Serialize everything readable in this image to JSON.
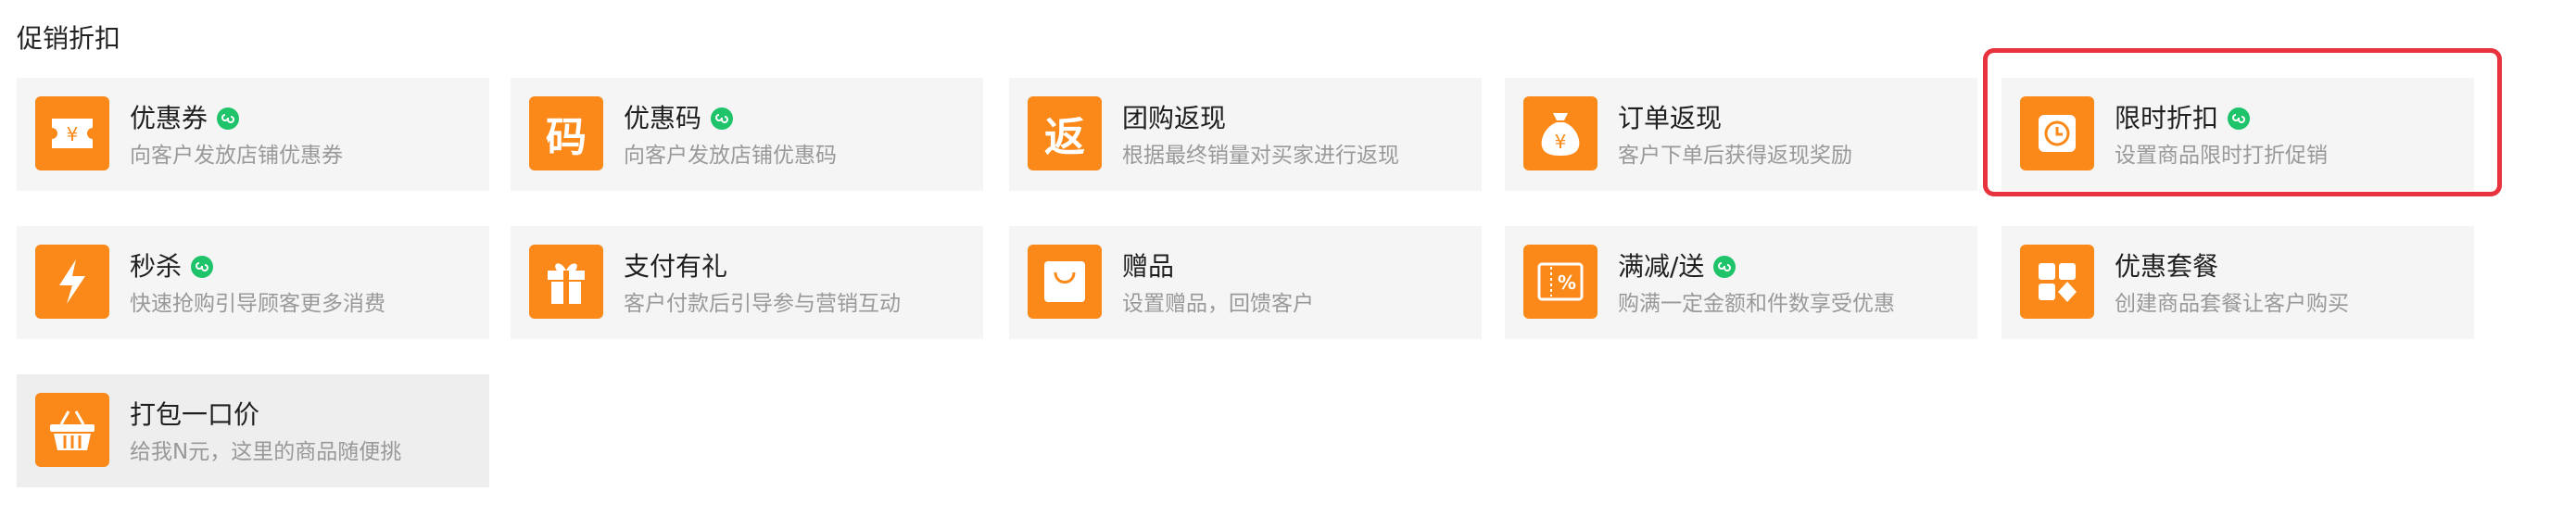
{
  "section": {
    "title": "促销折扣"
  },
  "cards": [
    {
      "title": "优惠券",
      "desc": "向客户发放店铺优惠券",
      "icon": "ticket-icon",
      "mini_program": true
    },
    {
      "title": "优惠码",
      "desc": "向客户发放店铺优惠码",
      "icon": "code-char-icon",
      "icon_text": "码",
      "mini_program": true
    },
    {
      "title": "团购返现",
      "desc": "根据最终销量对买家进行返现",
      "icon": "return-char-icon",
      "icon_text": "返",
      "mini_program": false
    },
    {
      "title": "订单返现",
      "desc": "客户下单后获得返现奖励",
      "icon": "money-bag-icon",
      "icon_text": "¥",
      "mini_program": false
    },
    {
      "title": "限时折扣",
      "desc": "设置商品限时打折促销",
      "icon": "clock-icon",
      "mini_program": true
    },
    {
      "title": "秒杀",
      "desc": "快速抢购引导顾客更多消费",
      "icon": "lightning-icon",
      "mini_program": true
    },
    {
      "title": "支付有礼",
      "desc": "客户付款后引导参与营销互动",
      "icon": "gift-icon",
      "mini_program": false
    },
    {
      "title": "赠品",
      "desc": "设置赠品，回馈客户",
      "icon": "shopping-bag-icon",
      "mini_program": false
    },
    {
      "title": "满减/送",
      "desc": "购满一定金额和件数享受优惠",
      "icon": "percent-coupon-icon",
      "icon_text": "%",
      "mini_program": true
    },
    {
      "title": "优惠套餐",
      "desc": "创建商品套餐让客户购买",
      "icon": "package-shapes-icon",
      "mini_program": false
    },
    {
      "title": "打包一口价",
      "desc": "给我N元，这里的商品随便挑",
      "icon": "basket-icon",
      "mini_program": false
    }
  ],
  "colors": {
    "accent": "#fa8919",
    "mini_program_badge": "#1ec36a",
    "highlight_border": "#e8323d",
    "card_background": "#f5f5f5"
  },
  "highlighted_card": "限时折扣"
}
